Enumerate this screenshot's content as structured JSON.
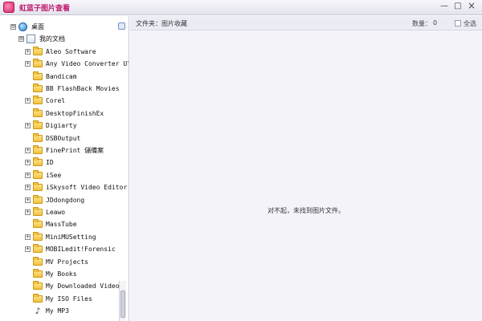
{
  "window": {
    "title": "虹蓝子图片查看",
    "minimize": "—",
    "maximize": "□",
    "close": "×"
  },
  "tree": {
    "items": [
      {
        "label": "桌面",
        "icon": "desktop-icon",
        "level": 0,
        "expander": "⊟"
      },
      {
        "label": "我的文档",
        "icon": "documents-icon",
        "level": 1,
        "expander": "⊟"
      },
      {
        "label": "Aleo Software",
        "icon": "folder-icon",
        "level": 2,
        "expander": "+"
      },
      {
        "label": "Any Video Converter Ultim",
        "icon": "folder-icon",
        "level": 2,
        "expander": "+"
      },
      {
        "label": "Bandicam",
        "icon": "folder-icon",
        "level": 2,
        "expander": ""
      },
      {
        "label": "BB FlashBack Movies",
        "icon": "folder-icon",
        "level": 2,
        "expander": ""
      },
      {
        "label": "Corel",
        "icon": "folder-icon",
        "level": 2,
        "expander": "+"
      },
      {
        "label": "DesktopFinishEx",
        "icon": "folder-icon",
        "level": 2,
        "expander": ""
      },
      {
        "label": "Digiarty",
        "icon": "folder-icon",
        "level": 2,
        "expander": "+"
      },
      {
        "label": "DSBOutput",
        "icon": "folder-icon",
        "level": 2,
        "expander": ""
      },
      {
        "label": "FinePrint 儲備案",
        "icon": "folder-icon",
        "level": 2,
        "expander": "+"
      },
      {
        "label": "ID",
        "icon": "folder-icon",
        "level": 2,
        "expander": "+"
      },
      {
        "label": "iSee",
        "icon": "folder-icon",
        "level": 2,
        "expander": "+"
      },
      {
        "label": "iSkysoft Video Editor",
        "icon": "folder-icon",
        "level": 2,
        "expander": "+"
      },
      {
        "label": "JDdongdong",
        "icon": "folder-icon",
        "level": 2,
        "expander": "+"
      },
      {
        "label": "Leawo",
        "icon": "folder-icon",
        "level": 2,
        "expander": "+"
      },
      {
        "label": "MassTube",
        "icon": "folder-icon",
        "level": 2,
        "expander": ""
      },
      {
        "label": "MiniMUSetting",
        "icon": "folder-icon",
        "level": 2,
        "expander": "+"
      },
      {
        "label": "MOBILedit!Forensic",
        "icon": "folder-icon",
        "level": 2,
        "expander": "+"
      },
      {
        "label": "MV Projects",
        "icon": "folder-icon",
        "level": 2,
        "expander": ""
      },
      {
        "label": "My Books",
        "icon": "folder-icon",
        "level": 2,
        "expander": ""
      },
      {
        "label": "My Downloaded Video",
        "icon": "folder-icon",
        "level": 2,
        "expander": ""
      },
      {
        "label": "My ISO Files",
        "icon": "folder-icon",
        "level": 2,
        "expander": ""
      },
      {
        "label": "My MP3",
        "icon": "music-icon",
        "level": 2,
        "expander": ""
      }
    ]
  },
  "content": {
    "folder_label": "文件夹：图片收藏",
    "count_label": "数量：",
    "count_value": "0",
    "select_all_label": "全选",
    "empty_message": "对不起，未找到图片文件。"
  },
  "colors": {
    "title_text": "#c0186b",
    "content_background": "#f3f3f9"
  }
}
